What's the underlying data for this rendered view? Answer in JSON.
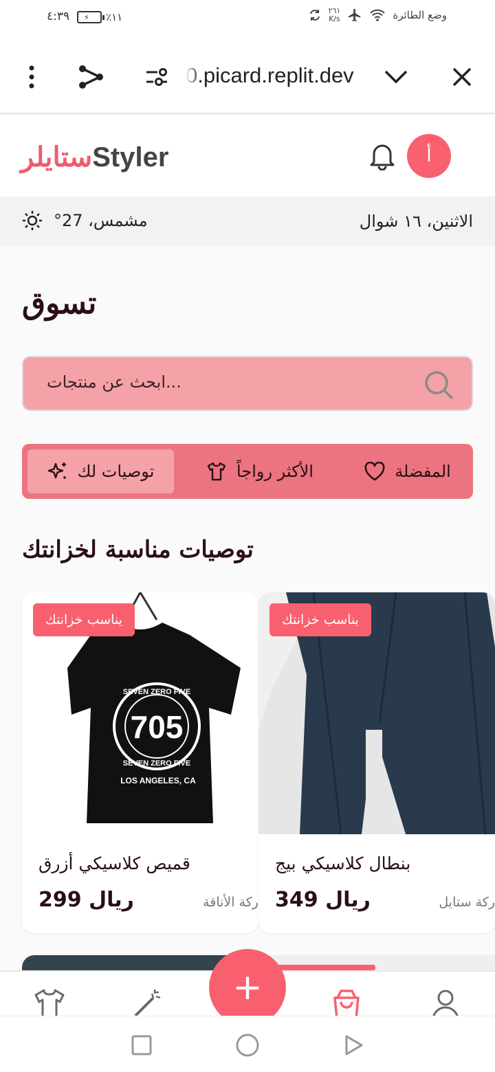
{
  "status_bar": {
    "time": "٤:٣٩",
    "battery_percent": "٪١١",
    "network_speed_value": "٢٦١",
    "network_speed_unit": "K/s",
    "airplane_mode_label": "وضع الطائرة"
  },
  "browser": {
    "url": "0.picard.replit.dev"
  },
  "app": {
    "logo_arabic": "ستايلر",
    "logo_english": "Styler",
    "avatar_initial": "أ",
    "accent_color": "#f9606f"
  },
  "info_bar": {
    "weather_text": "°مشمس، 27",
    "date_text": "الاثنين، ١٦ شوال"
  },
  "main": {
    "page_title": "تسوق",
    "search_placeholder": "...ابحث عن منتجات",
    "tabs": [
      {
        "label": "توصيات لك",
        "icon": "sparkles-icon",
        "active": true
      },
      {
        "label": "الأكثر رواجاً",
        "icon": "shirt-icon",
        "active": false
      },
      {
        "label": "المفضلة",
        "icon": "heart-icon",
        "active": false
      }
    ],
    "section_title": "توصيات مناسبة لخزانتك"
  },
  "products": [
    {
      "badge": "يناسب خزانتك",
      "name": "قميص كلاسيكي أزرق",
      "currency": "ريال",
      "price": "299",
      "brand": "ركة الأناقة",
      "image_text_top": "SEVEN ZERO FIVE",
      "image_text_number": "705",
      "image_text_bottom": "SEVEN ZERO FIVE",
      "image_text_city": "LOS ANGELES, CA"
    },
    {
      "badge": "يناسب خزانتك",
      "name": "بنطال كلاسيكي بيج",
      "currency": "ريال",
      "price": "349",
      "brand": "ركة ستايل"
    }
  ],
  "bottom_nav": {
    "items": [
      "shirt-icon",
      "magic-wand-icon",
      "add-icon",
      "shopping-bag-icon",
      "user-icon"
    ],
    "active": "shopping-bag-icon"
  }
}
